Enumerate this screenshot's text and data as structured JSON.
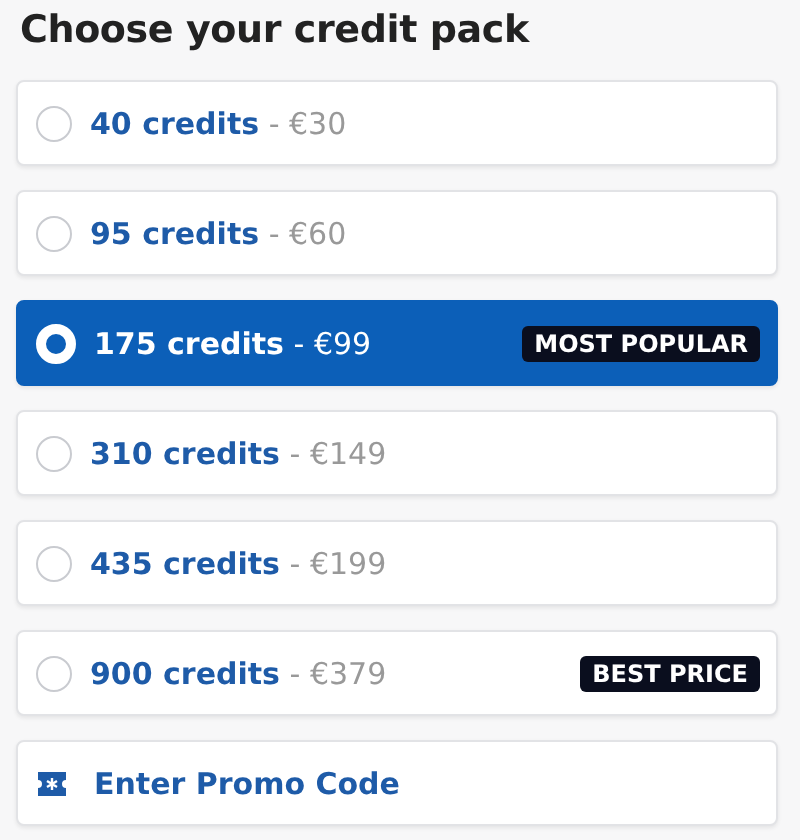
{
  "heading": "Choose your credit pack",
  "options": [
    {
      "credits": "40 credits",
      "price": "- €30",
      "selected": false
    },
    {
      "credits": "95 credits",
      "price": "- €60",
      "selected": false
    },
    {
      "credits": "175 credits",
      "price": "- €99",
      "selected": true,
      "badge": "MOST POPULAR"
    },
    {
      "credits": "310 credits",
      "price": "- €149",
      "selected": false
    },
    {
      "credits": "435 credits",
      "price": "- €199",
      "selected": false
    },
    {
      "credits": "900 credits",
      "price": "- €379",
      "selected": false,
      "badge": "BEST PRICE"
    }
  ],
  "promo": {
    "label": "Enter Promo Code"
  }
}
